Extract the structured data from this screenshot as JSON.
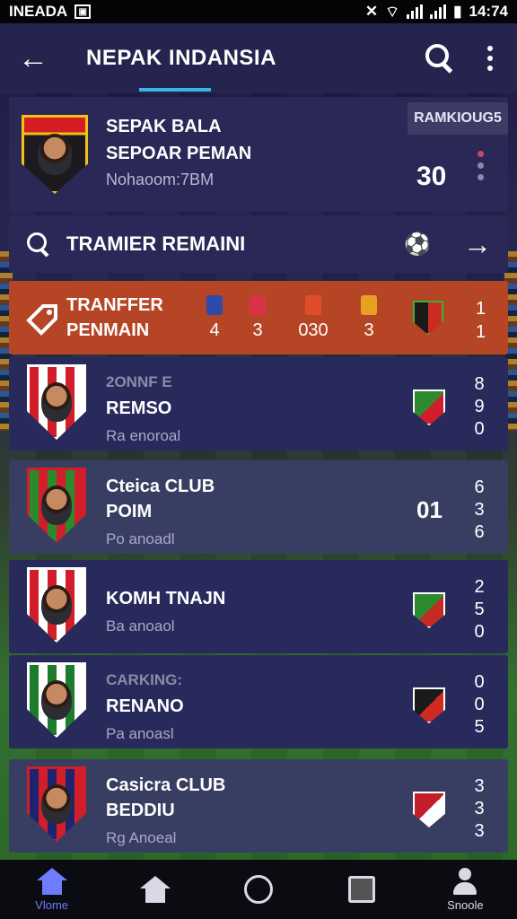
{
  "status_bar": {
    "carrier": "INEADA",
    "time": "14:74"
  },
  "app_bar": {
    "title": "NEPAK INDANSIA"
  },
  "profile": {
    "line1": "SEPAK BALA",
    "line2": "SEPOAR PEMAN",
    "line3": "Nohaoom:7BM",
    "badge": "RAMKIOUG5",
    "number": "30"
  },
  "search_row": {
    "label": "TRAMIER REMAINI"
  },
  "transfer": {
    "line1": "TRANFFER",
    "line2": "PENMAIN",
    "values": [
      "4",
      "3",
      "030",
      "3"
    ],
    "mini_colors": [
      "#2d4ba8",
      "#d8324a",
      "#e24c2b",
      "#e6a121"
    ],
    "side": [
      "1",
      "1"
    ]
  },
  "clubs": [
    {
      "line1": "2ONNF E",
      "line2": "REMSO",
      "line3": "Ra enoroal",
      "score": "",
      "stack": [
        "8",
        "9",
        "0"
      ],
      "crest_color": "#d21d2a",
      "crest_alt": "#ffffff",
      "small_crest": [
        "#2e8a2e",
        "#d21d2a"
      ]
    },
    {
      "line1": "Cteica CLUB",
      "line2": "POIM",
      "line3": "Po anoadl",
      "score": "01",
      "stack": [
        "6",
        "3",
        "6"
      ],
      "crest_color": "#2c8a2b",
      "crest_alt": "#d21d2a",
      "small_crest": []
    },
    {
      "line1": "",
      "line2": "KOMH TNAJN",
      "line3": "Ba anoaol",
      "score": "",
      "stack": [
        "2",
        "5",
        "0"
      ],
      "crest_color": "#d21d2a",
      "crest_alt": "#ffffff",
      "small_crest": [
        "#2e8a2e",
        "#c62a22"
      ]
    },
    {
      "line1": "CARKING:",
      "line2": "RENANO",
      "line3": "Pa anoasl",
      "score": "",
      "stack": [
        "0",
        "0",
        "5"
      ],
      "crest_color": "#1c7c2b",
      "crest_alt": "#ffffff",
      "small_crest": [
        "#1a1a1a",
        "#d22a20"
      ]
    },
    {
      "line1": "Casicra CLUB",
      "line2": "BEDDIU",
      "line3": "Rg Anoeal",
      "score": "",
      "stack": [
        "3",
        "3",
        "3"
      ],
      "crest_color": "#1f2470",
      "crest_alt": "#d21d2a",
      "small_crest": [
        "#c21f2a",
        "#ffffff"
      ]
    }
  ],
  "bottom_nav": [
    {
      "label": "Vlome",
      "icon": "home-icon",
      "active": true
    },
    {
      "label": "",
      "icon": "home-icon",
      "active": false
    },
    {
      "label": "",
      "icon": "circle-icon",
      "active": false
    },
    {
      "label": "",
      "icon": "square-icon",
      "active": false
    },
    {
      "label": "Snoole",
      "icon": "person-icon",
      "active": false
    }
  ]
}
